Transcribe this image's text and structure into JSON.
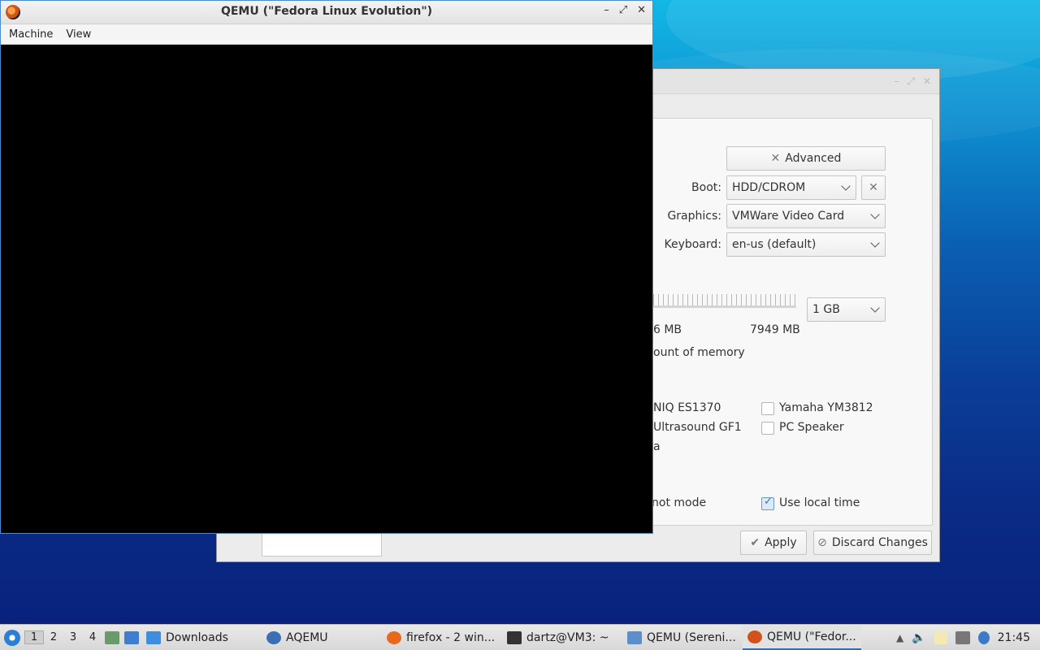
{
  "qemu_window": {
    "title": "QEMU (\"Fedora Linux Evolution\")",
    "controls": {
      "minimize": "–",
      "maximize": "⤢",
      "close": "✕"
    },
    "menu": [
      "Machine",
      "View"
    ]
  },
  "aqemu_window": {
    "advanced_label": "Advanced",
    "boot_label": "Boot:",
    "boot_value": "HDD/CDROM",
    "graphics_label": "Graphics:",
    "graphics_value": "VMWare Video Card",
    "keyboard_label": "Keyboard:",
    "keyboard_value": "en-us (default)",
    "memory_value": "1 GB",
    "mem_min_partial": "6 MB",
    "mem_max": "7949 MB",
    "mem_note_partial": "ount of memory",
    "sound_es1370_partial": "NIQ ES1370",
    "sound_gus_partial": "Ultrasound GF1",
    "sound_partial_a": "a",
    "sound_yamaha": "Yamaha YM3812",
    "sound_pcspeaker": "PC Speaker",
    "snapshot_partial": "not mode",
    "use_local_time": "Use local time",
    "apply_label": "Apply",
    "discard_label": "Discard Changes"
  },
  "taskbar": {
    "workspaces": [
      "1",
      "2",
      "3",
      "4"
    ],
    "items": [
      {
        "label": "Downloads",
        "icon": "folder-icon",
        "color": "#3d8ee0"
      },
      {
        "label": "AQEMU",
        "icon": "aqemu-icon",
        "color": "#3b6fb5"
      },
      {
        "label": "firefox - 2 win...",
        "icon": "firefox-icon",
        "color": "#e8691e"
      },
      {
        "label": "dartz@VM3: ~",
        "icon": "terminal-icon",
        "color": "#333333"
      },
      {
        "label": "QEMU (Sereni...",
        "icon": "window-icon",
        "color": "#5c8fc9"
      },
      {
        "label": "QEMU (\"Fedor...",
        "icon": "qemu-icon",
        "color": "#d1531c"
      }
    ],
    "clock": "21:45"
  }
}
